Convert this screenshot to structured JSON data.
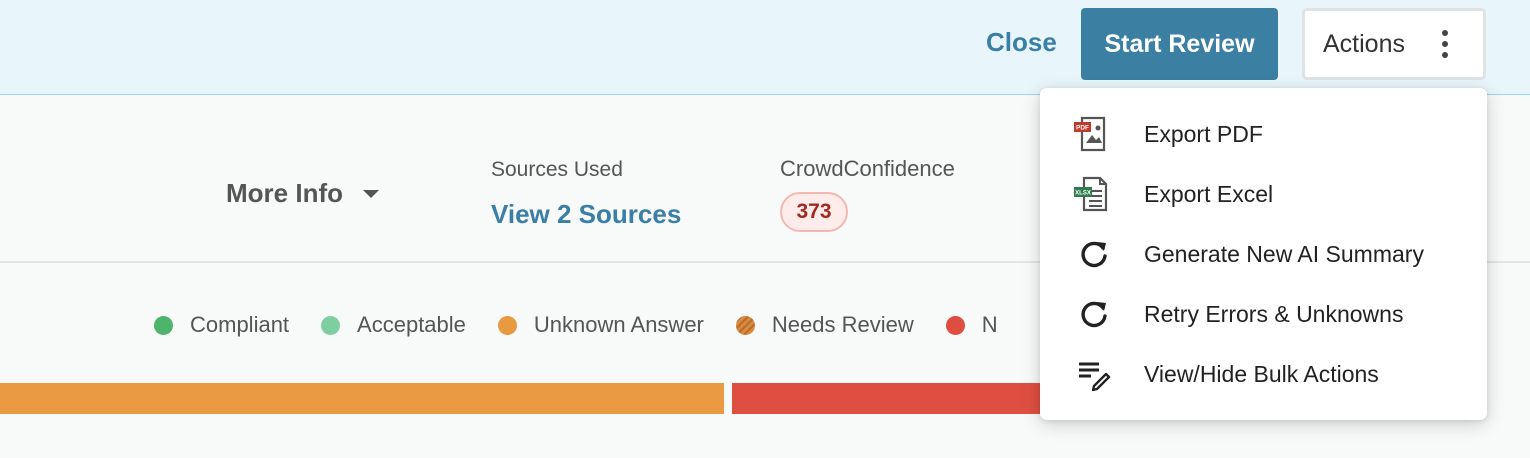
{
  "header": {
    "close_label": "Close",
    "start_review_label": "Start Review",
    "actions_label": "Actions"
  },
  "info": {
    "more_info_label": "More Info",
    "sources_label": "Sources Used",
    "sources_link": "View 2 Sources",
    "crowd_label": "CrowdConfidence",
    "crowd_value": "373"
  },
  "legend": {
    "items": [
      {
        "label": "Compliant",
        "color": "#4cb56b"
      },
      {
        "label": "Acceptable",
        "color": "#7ecfa0"
      },
      {
        "label": "Unknown Answer",
        "color": "#e9993f"
      },
      {
        "label": "Needs Review",
        "color": "#c97b35"
      },
      {
        "label": "N",
        "color": "#de4d40"
      }
    ]
  },
  "menu": {
    "items": [
      {
        "label": "Export PDF",
        "icon": "pdf-file-icon",
        "badge": "PDF"
      },
      {
        "label": "Export Excel",
        "icon": "excel-file-icon",
        "badge": "XLSX"
      },
      {
        "label": "Generate New AI Summary",
        "icon": "refresh-icon"
      },
      {
        "label": "Retry Errors & Unknowns",
        "icon": "refresh-icon"
      },
      {
        "label": "View/Hide Bulk Actions",
        "icon": "edit-list-icon"
      }
    ]
  },
  "colors": {
    "primary": "#3b7fa3",
    "link": "#3a7fa5",
    "header_bg": "#e8f6fb",
    "bar_orange": "#e99a43",
    "bar_red": "#df4f41"
  }
}
